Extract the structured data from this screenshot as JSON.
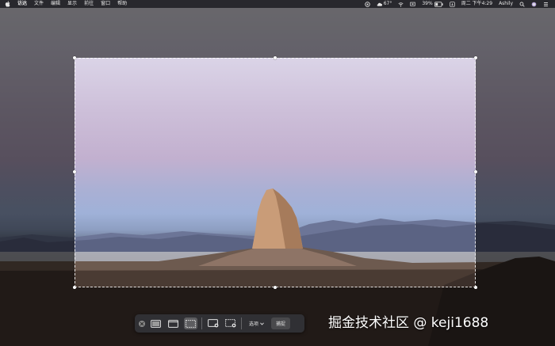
{
  "menubar": {
    "app_name": "访达",
    "menus": [
      "文件",
      "编辑",
      "显示",
      "前往",
      "窗口",
      "帮助"
    ],
    "battery_temp": "67°",
    "battery": "39%",
    "clock": "周二 下午4:29",
    "user": "Ashily"
  },
  "toolbar": {
    "options_label": "选项",
    "capture_label": "捕捉"
  },
  "watermark": {
    "text": "掘金技术社区 @ keji1688"
  },
  "colors": {
    "menubar_bg": "#1e1e22",
    "toolbar_bg": "#323237",
    "selection_border": "#ffffff"
  }
}
